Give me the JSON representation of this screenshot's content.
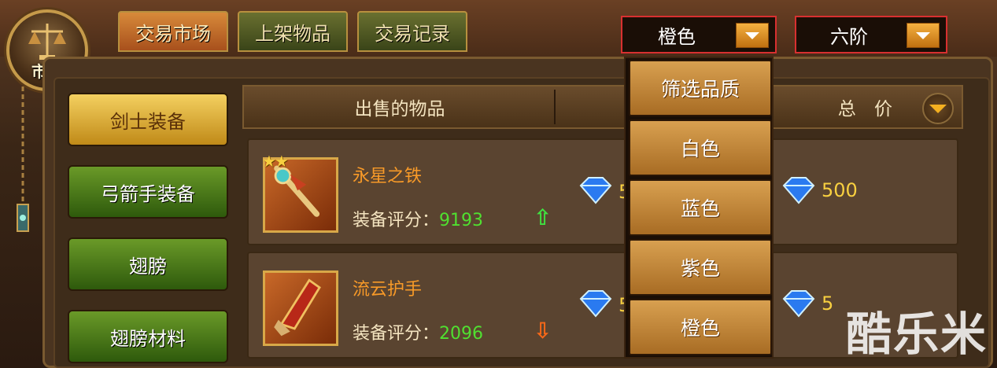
{
  "market_emblem": {
    "label": "市场"
  },
  "tabs": [
    {
      "label": "交易市场",
      "active": true
    },
    {
      "label": "上架物品",
      "active": false
    },
    {
      "label": "交易记录",
      "active": false
    }
  ],
  "filters": {
    "quality": {
      "value": "橙色"
    },
    "tier": {
      "value": "六阶"
    }
  },
  "categories": [
    {
      "label": "剑士装备",
      "active": true
    },
    {
      "label": "弓箭手装备",
      "active": false
    },
    {
      "label": "翅膀",
      "active": false
    },
    {
      "label": "翅膀材料",
      "active": false
    }
  ],
  "table_header": {
    "item_col": "出售的物品",
    "total_col": "总 价"
  },
  "rows": [
    {
      "name": "永星之铁",
      "score_label": "装备评分：",
      "score_value": "9193",
      "trend": "up",
      "unit_price_partial": "5",
      "total": "500",
      "stars": "★★"
    },
    {
      "name": "流云护手",
      "score_label": "装备评分：",
      "score_value": "2096",
      "trend": "down",
      "unit_price_partial": "5",
      "total": "5",
      "stars": ""
    }
  ],
  "quality_menu": {
    "options": [
      "筛选品质",
      "白色",
      "蓝色",
      "紫色",
      "橙色"
    ]
  },
  "watermark": "酷乐米",
  "colors": {
    "accent_orange": "#f4b040",
    "name_orange": "#f89a28",
    "score_green": "#50e030",
    "up_green": "#40e040",
    "down_orange": "#f86818",
    "highlight_red": "#d83030"
  }
}
